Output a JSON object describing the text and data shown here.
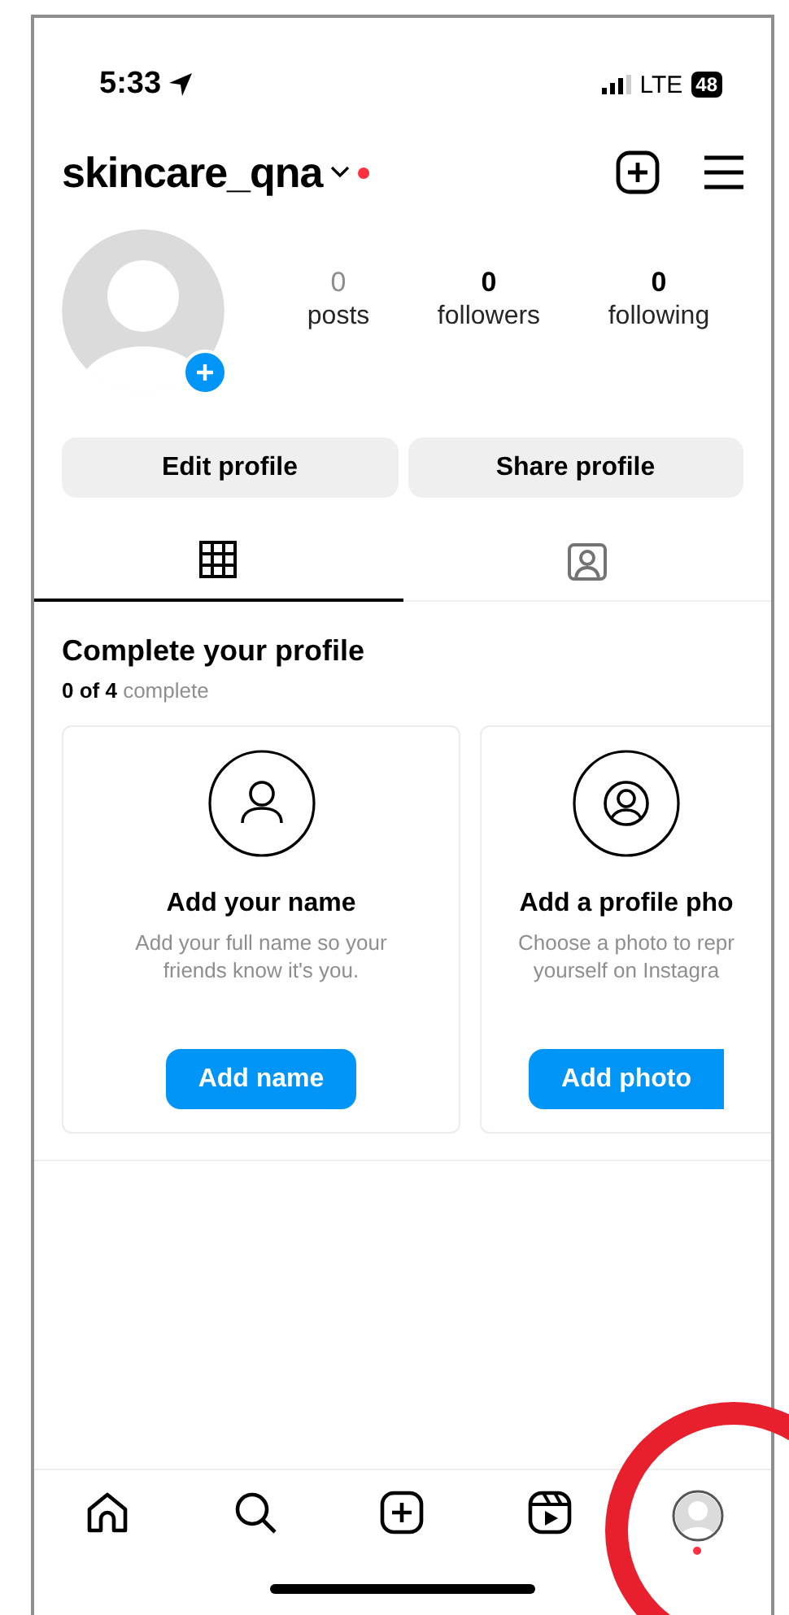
{
  "status_bar": {
    "time": "5:33",
    "network": "LTE",
    "battery": "48"
  },
  "header": {
    "username": "skincare_qna",
    "notification_dot": true
  },
  "profile": {
    "stats": [
      {
        "value": "0",
        "label": "posts",
        "muted": true
      },
      {
        "value": "0",
        "label": "followers",
        "muted": false
      },
      {
        "value": "0",
        "label": "following",
        "muted": false
      }
    ]
  },
  "actions": [
    "Edit profile",
    "Share profile"
  ],
  "tabs": [
    {
      "kind": "grid",
      "selected": true
    },
    {
      "kind": "tagged",
      "selected": false
    }
  ],
  "complete_profile": {
    "title": "Complete your profile",
    "progress": "**0 of 4** complete",
    "cards": [
      {
        "kind": "name",
        "title": "Add your name",
        "description": [
          "Add your full name so your",
          "friends know it's you."
        ],
        "button": "Add name"
      },
      {
        "kind": "photo",
        "title": "Add a profile pho",
        "description": [
          "Choose a photo to repr",
          "yourself on Instagra"
        ],
        "button": "Add photo"
      }
    ]
  },
  "bottom_nav": [
    {
      "kind": "home",
      "notification_dot": false
    },
    {
      "kind": "search",
      "notification_dot": false
    },
    {
      "kind": "create",
      "notification_dot": false
    },
    {
      "kind": "reels",
      "notification_dot": false
    },
    {
      "kind": "profile",
      "notification_dot": true
    }
  ]
}
